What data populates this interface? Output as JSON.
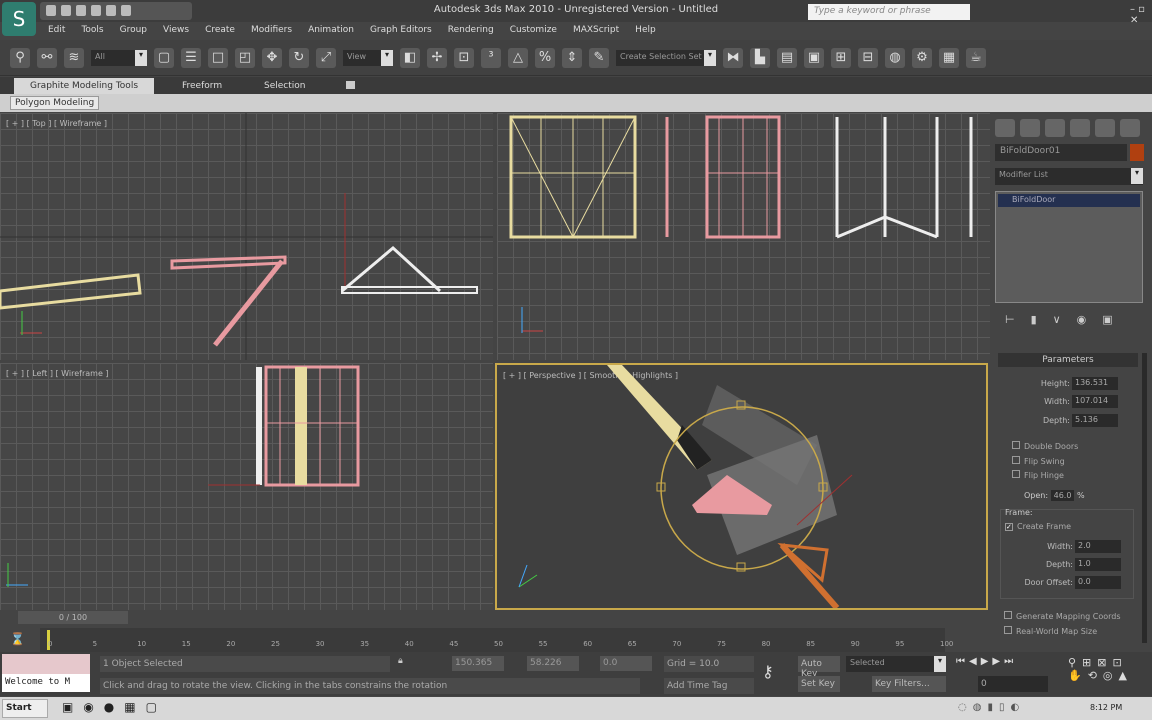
{
  "titlebar": {
    "title": "Autodesk 3ds Max 2010 - Unregistered Version - Untitled",
    "search_placeholder": "Type a keyword or phrase"
  },
  "menu": [
    "Edit",
    "Tools",
    "Group",
    "Views",
    "Create",
    "Modifiers",
    "Animation",
    "Graph Editors",
    "Rendering",
    "Customize",
    "MAXScript",
    "Help"
  ],
  "toolbar": {
    "filter": "All",
    "ref_coord": "View",
    "named_selection": "Create Selection Set"
  },
  "ribbon": {
    "tabs": [
      "Graphite Modeling Tools",
      "Freeform",
      "Selection"
    ],
    "panel": "Polygon Modeling"
  },
  "viewports": {
    "top": "[ + ] [ Top ] [ Wireframe ]",
    "front": "",
    "left": "[ + ] [ Left ] [ Wireframe ]",
    "perspective": "[ + ] [ Perspective ] [ Smooth + Highlights ]"
  },
  "command_panel": {
    "object_name": "BiFoldDoor01",
    "object_color": "#b04010",
    "modifier_list": "Modifier List",
    "stack": [
      "BiFoldDoor"
    ],
    "parameters": {
      "title": "Parameters",
      "height_label": "Height:",
      "height": "136.531",
      "width_label": "Width:",
      "width": "107.014",
      "depth_label": "Depth:",
      "depth": "5.136",
      "double_doors": "Double Doors",
      "flip_swing": "Flip Swing",
      "flip_hinge": "Flip Hinge",
      "open_label": "Open:",
      "open": "46.0",
      "open_unit": "%",
      "frame_group": "Frame:",
      "create_frame": "Create Frame",
      "frame_width_label": "Width:",
      "frame_width": "2.0",
      "frame_depth_label": "Depth:",
      "frame_depth": "1.0",
      "door_offset_label": "Door Offset:",
      "door_offset": "0.0",
      "gen_mapping": "Generate Mapping Coords",
      "real_world": "Real-World Map Size"
    }
  },
  "timeline": {
    "position": "0 / 100",
    "ticks": [
      "0",
      "5",
      "10",
      "15",
      "20",
      "25",
      "30",
      "35",
      "40",
      "45",
      "50",
      "55",
      "60",
      "65",
      "70",
      "75",
      "80",
      "85",
      "90",
      "95",
      "100"
    ]
  },
  "status": {
    "listener": "Welcome to M",
    "selection": "1 Object Selected",
    "prompt": "Click and drag to rotate the view.  Clicking in the tabs constrains the rotation",
    "x": "150.365",
    "y": "58.226",
    "z": "0.0",
    "grid": "Grid = 10.0",
    "auto_key": "Auto Key",
    "set_key": "Set Key",
    "key_mode": "Selected",
    "key_filters": "Key Filters...",
    "add_time_tag": "Add Time Tag",
    "frame": "0"
  },
  "taskbar": {
    "start": "Start",
    "clock": "8:12 PM"
  }
}
